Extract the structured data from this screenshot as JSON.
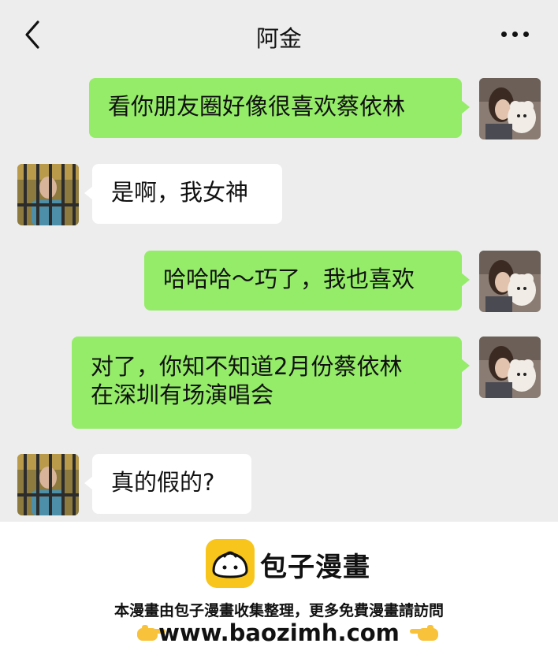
{
  "header": {
    "title": "阿金"
  },
  "messages": [
    {
      "side": "me",
      "text": "看你朋友圈好像很喜欢蔡依林"
    },
    {
      "side": "other",
      "text": "是啊，我女神"
    },
    {
      "side": "me",
      "text": "哈哈哈～巧了，我也喜欢"
    },
    {
      "side": "me",
      "line1": "对了，你知不知道2月份蔡依林",
      "line2": "在深圳有场演唱会"
    },
    {
      "side": "other",
      "text": "真的假的?"
    }
  ],
  "footer": {
    "brand": "包子漫畫",
    "notice": "本漫畫由包子漫畫收集整理，更多免費漫畫請訪問",
    "url": "www.baozimh.com"
  },
  "colors": {
    "my_bubble": "#95ec69",
    "other_bubble": "#ffffff",
    "background": "#ededed",
    "logo": "#f7c51b"
  }
}
